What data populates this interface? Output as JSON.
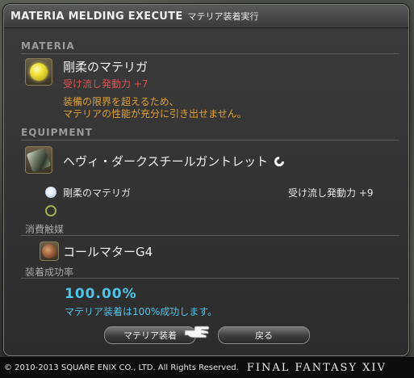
{
  "window": {
    "title_en": "MATERIA MELDING EXECUTE",
    "title_jp": "マテリア装着実行"
  },
  "materia": {
    "section_label": "MATERIA",
    "item_name": "剛柔のマテリガ",
    "stat_bonus": "受け流し発動力 +7",
    "warning_line1": "装備の限界を超えるため、",
    "warning_line2": "マテリアの性能が充分に引き出せません。"
  },
  "equipment": {
    "section_label": "EQUIPMENT",
    "item_name": "ヘヴィ・ダークスチールガントレット",
    "melded_materia": "剛柔のマテリガ",
    "melded_stat": "受け流し発動力 +9"
  },
  "catalyst": {
    "section_label": "消費触媒",
    "item_name": "コールマターG4"
  },
  "success": {
    "section_label": "装着成功率",
    "rate": "100.00%",
    "message": "マテリア装着は100%成功します。"
  },
  "buttons": {
    "confirm_label": "マテリア装着",
    "back_label": "戻る"
  },
  "footer": {
    "copyright": "© 2010-2013 SQUARE ENIX CO., LTD. All Rights Reserved.",
    "game_logo": "FINAL FANTASY XIV"
  },
  "colors": {
    "warning_red": "#e05050",
    "warning_orange": "#e0a030",
    "rate_cyan": "#4ec4e8"
  }
}
